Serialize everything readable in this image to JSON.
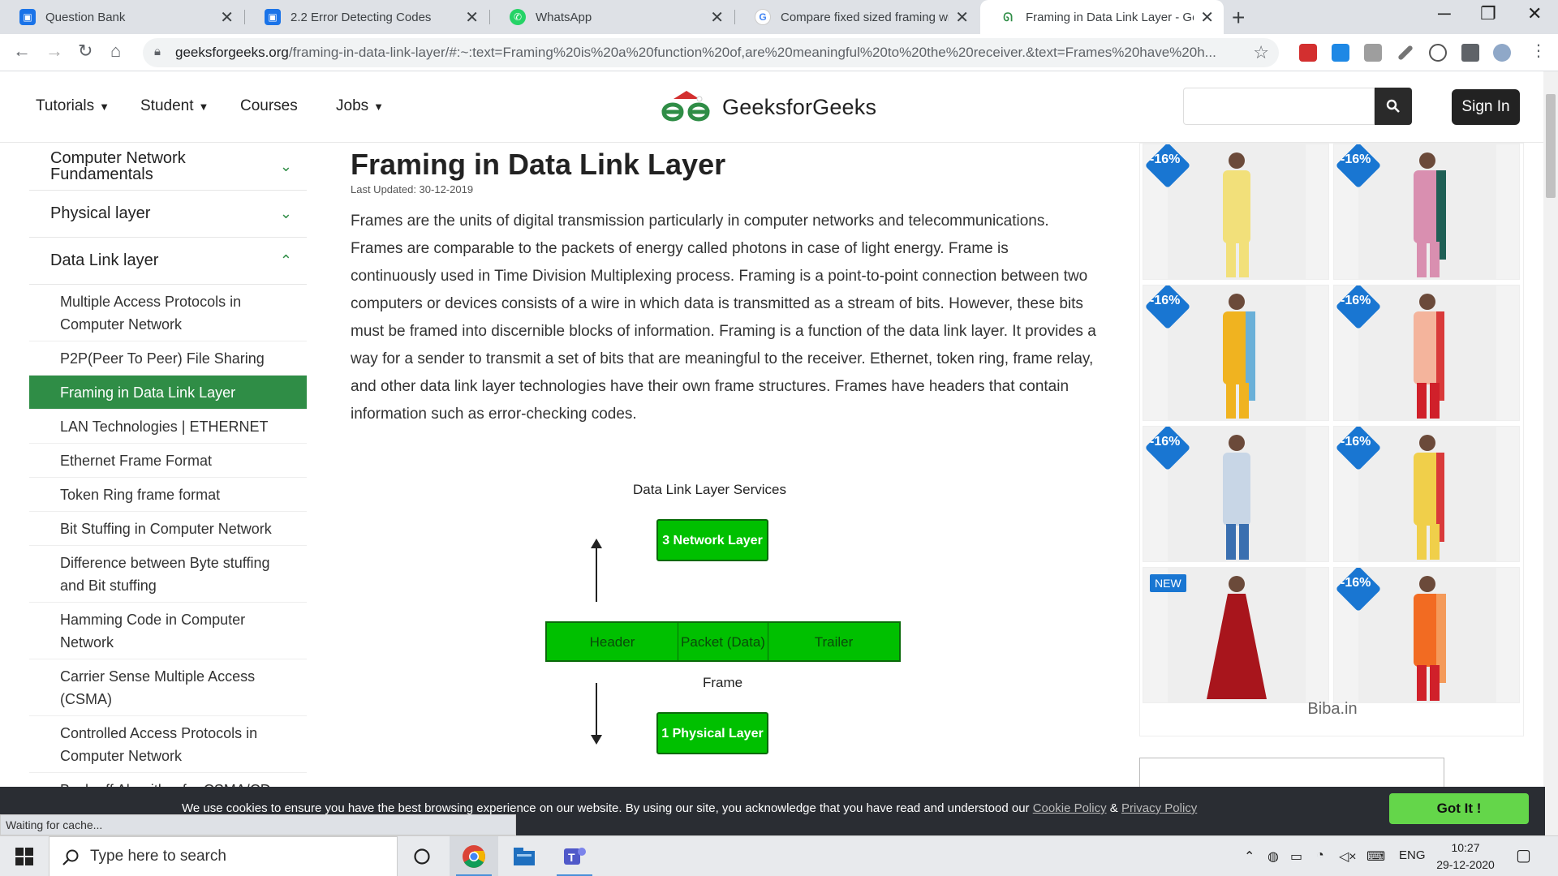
{
  "browser": {
    "tabs": [
      {
        "title": "Question Bank",
        "favicon": "classroom-icon",
        "color": "#1a73e8"
      },
      {
        "title": "2.2 Error Detecting Codes",
        "favicon": "classroom-icon",
        "color": "#1a73e8"
      },
      {
        "title": "WhatsApp",
        "favicon": "whatsapp-icon",
        "color": "#25d366"
      },
      {
        "title": "Compare fixed sized framing with",
        "favicon": "google-icon",
        "color": "#4285f4"
      },
      {
        "title": "Framing in Data Link Layer - Gee",
        "favicon": "gfg-icon",
        "color": "#2f8d46"
      }
    ],
    "url_host": "geeksforgeeks.org",
    "url_path": "/framing-in-data-link-layer/#:~:text=Framing%20is%20a%20function%20of,are%20meaningful%20to%20the%20receiver.&text=Frames%20have%20h..."
  },
  "header": {
    "nav": [
      "Tutorials",
      "Student",
      "Courses",
      "Jobs"
    ],
    "logo_text": "GeeksforGeeks",
    "signin_label": "Sign In"
  },
  "sidebar": {
    "sections": [
      {
        "label": "Computer Network Fundamentals",
        "expanded": false
      },
      {
        "label": "Physical layer",
        "expanded": false
      },
      {
        "label": "Data Link layer",
        "expanded": true
      }
    ],
    "items": [
      "Multiple Access Protocols in Computer Network",
      "P2P(Peer To Peer) File Sharing",
      "Framing in Data Link Layer",
      "LAN Technologies | ETHERNET",
      "Ethernet Frame Format",
      "Token Ring frame format",
      "Bit Stuffing in Computer Network",
      "Difference between Byte stuffing and Bit stuffing",
      "Hamming Code in Computer Network",
      "Carrier Sense Multiple Access (CSMA)",
      "Controlled Access Protocols in Computer Network",
      "Back-off Algorithm for CSMA/CD"
    ],
    "active_index": 2
  },
  "article": {
    "title": "Framing in Data Link Layer",
    "updated": "Last Updated: 30-12-2019",
    "paragraph": "Frames are the units of digital transmission particularly in computer networks and telecommunications. Frames are comparable to the packets of energy called photons in case of light energy. Frame is continuously used in Time Division Multiplexing process. Framing is a point-to-point connection between two computers or devices consists of a wire in which data is transmitted as a stream of bits. However, these bits must be framed into discernible blocks of information. Framing is a function of the data link layer. It provides a way for a sender to transmit a set of bits that are meaningful to the receiver. Ethernet, token ring, frame relay, and other data link layer technologies have their own frame structures. Frames have headers that contain information such as error-checking codes."
  },
  "diagram": {
    "title": "Data Link Layer Services",
    "top_box": "3 Network Layer",
    "frame_cells": [
      "Header",
      "Packet (Data)",
      "Trailer"
    ],
    "frame_label": "Frame",
    "bottom_box": "1 Physical Layer"
  },
  "ads": {
    "badges": [
      "-16%",
      "-16%",
      "-16%",
      "-16%",
      "-16%",
      "-16%",
      "NEW",
      "-16%"
    ],
    "brand": "Biba.in",
    "outfit_colors": [
      "#f2e07a",
      "#d98fb0",
      "#f0b320",
      "#f4b49c",
      "#c8d6e6",
      "#f0cf4a",
      "#a8151c",
      "#f26b22"
    ]
  },
  "cookie": {
    "text": "We use cookies to ensure you have the best browsing experience on our website. By using our site, you acknowledge that you have read and understood our",
    "cookie_policy": "Cookie Policy",
    "amp": "&",
    "privacy_policy": "Privacy Policy",
    "button": "Got It !"
  },
  "status_text": "Waiting for cache...",
  "taskbar": {
    "search_placeholder": "Type here to search",
    "lang": "ENG",
    "time": "10:27",
    "date": "29-12-2020"
  }
}
